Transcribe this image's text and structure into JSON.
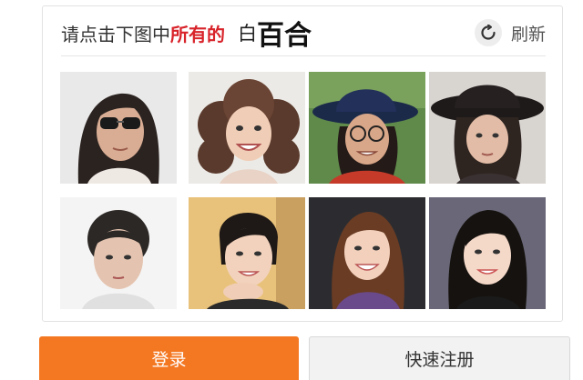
{
  "captcha": {
    "prompt_prefix": "请点击下图中",
    "prompt_highlight": "所有的",
    "target_small": "白",
    "target_large": "百合",
    "refresh_label": "刷新",
    "refresh_icon": "refresh-icon",
    "highlight_color": "#d8232a",
    "images": [
      {
        "name": "captcha-image-1"
      },
      {
        "name": "captcha-image-2"
      },
      {
        "name": "captcha-image-3"
      },
      {
        "name": "captcha-image-4"
      },
      {
        "name": "captcha-image-5"
      },
      {
        "name": "captcha-image-6"
      },
      {
        "name": "captcha-image-7"
      },
      {
        "name": "captcha-image-8"
      }
    ]
  },
  "actions": {
    "login_label": "登录",
    "register_label": "快速注册",
    "login_color": "#f47721"
  }
}
